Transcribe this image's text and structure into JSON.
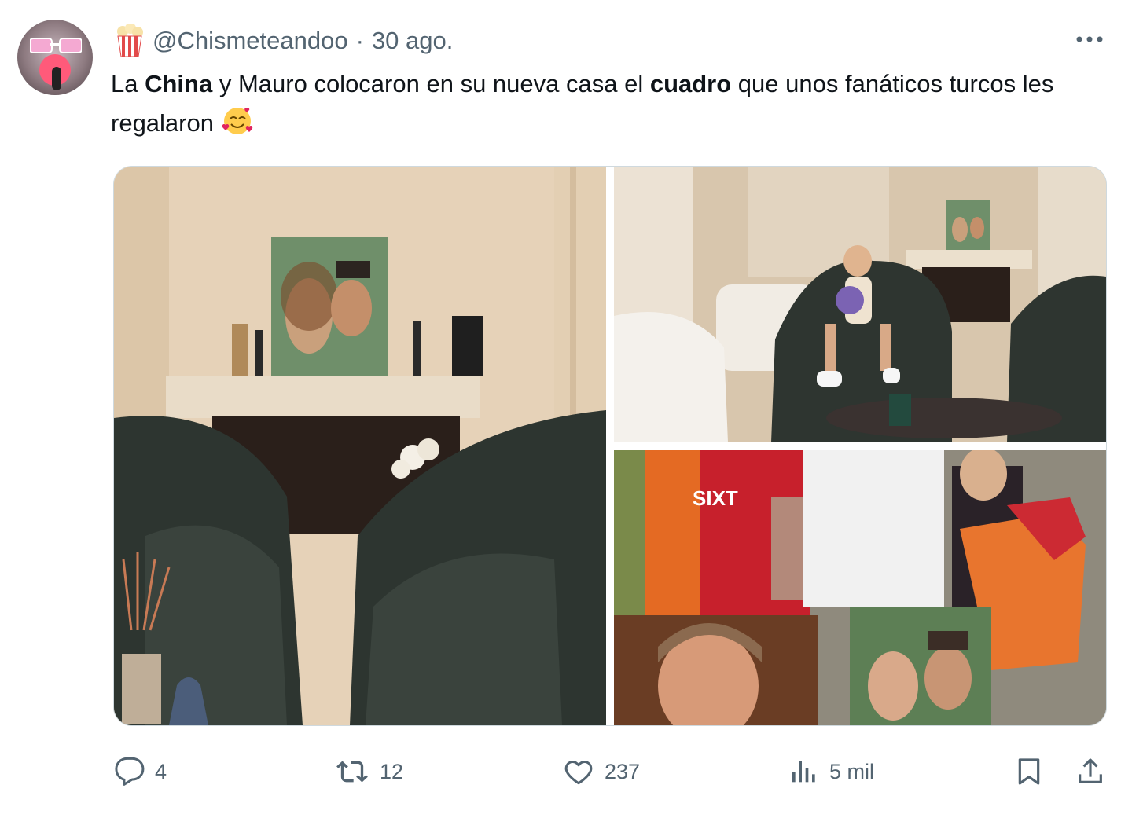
{
  "author": {
    "handle": "@Chismeteandoo",
    "separator": "·",
    "date": "30 ago.",
    "avatar_icon": "avatar-image",
    "badge_icon": "popcorn-icon"
  },
  "more_label": "···",
  "tweet": {
    "parts": [
      "La ",
      "China",
      " y Mauro colocaron en su nueva casa el ",
      "cuadro",
      " que unos fanáticos turcos les regalaron"
    ],
    "emoji_icon": "smiling-face-with-hearts-icon"
  },
  "media": {
    "images": [
      "living-room-photo",
      "girl-in-armchair-photo",
      "fans-with-portraits-photo"
    ]
  },
  "actions": {
    "reply_count": "4",
    "retweet_count": "12",
    "like_count": "237",
    "views_count": "5 mil"
  },
  "colors": {
    "text": "#0f1419",
    "secondary": "#536471",
    "border": "#cfd9de"
  }
}
